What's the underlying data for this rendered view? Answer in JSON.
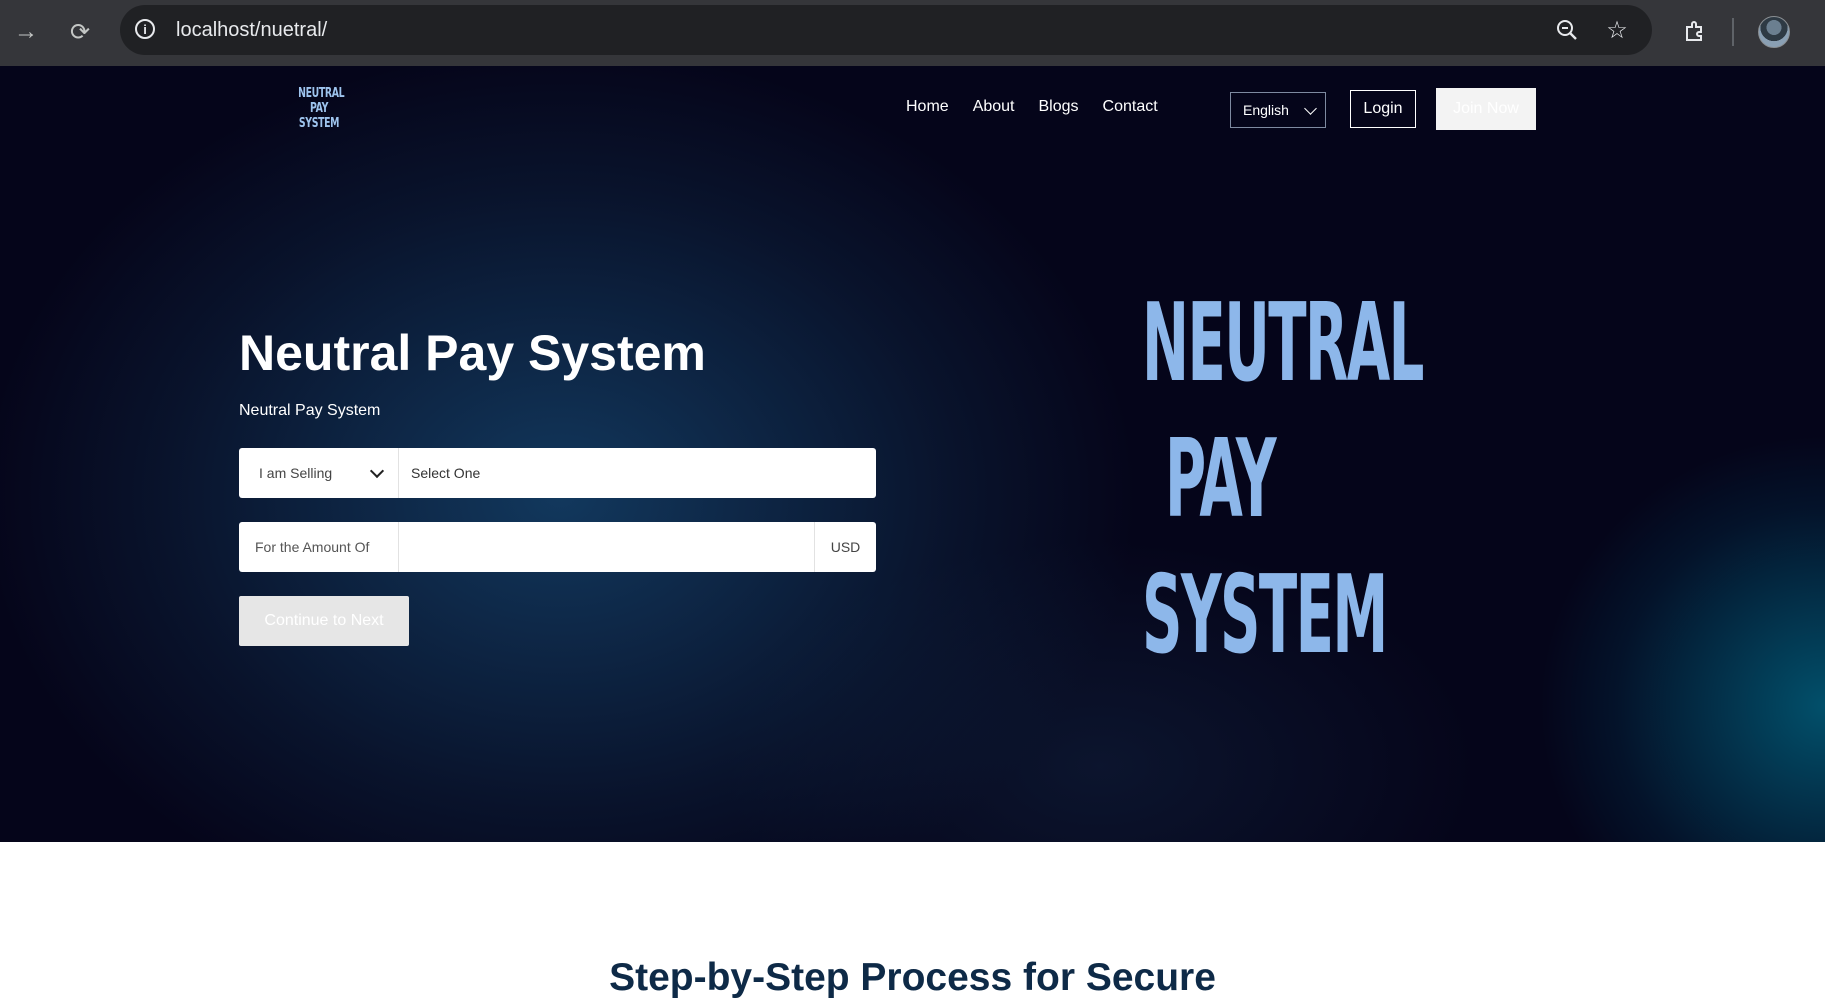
{
  "browser": {
    "url": "localhost/nuetral/",
    "icons": [
      "forward-icon",
      "reload-icon",
      "info-icon",
      "zoom-icon",
      "star-icon",
      "extensions-icon",
      "avatar"
    ]
  },
  "header": {
    "logo": [
      "NEUTRAL",
      "PAY",
      "SYSTEM"
    ],
    "nav": [
      "Home",
      "About",
      "Blogs",
      "Contact"
    ],
    "language": "English",
    "login": "Login",
    "join": "Join Now"
  },
  "hero": {
    "title": "Neutral Pay System",
    "subtitle": "Neutral Pay System",
    "sell_select": "I am Selling",
    "item_select": "Select One",
    "amount_label": "For the Amount Of",
    "amount_value": "",
    "currency": "USD",
    "continue": "Continue to Next",
    "big_logo": [
      "NEUTRAL",
      "PAY",
      "SYSTEM"
    ]
  },
  "section": {
    "title": "Step-by-Step Process for Secure"
  },
  "colors": {
    "hero_bg": "#05051a",
    "logo_blue": "#8db7ea",
    "heading_navy": "#0e2a47"
  }
}
